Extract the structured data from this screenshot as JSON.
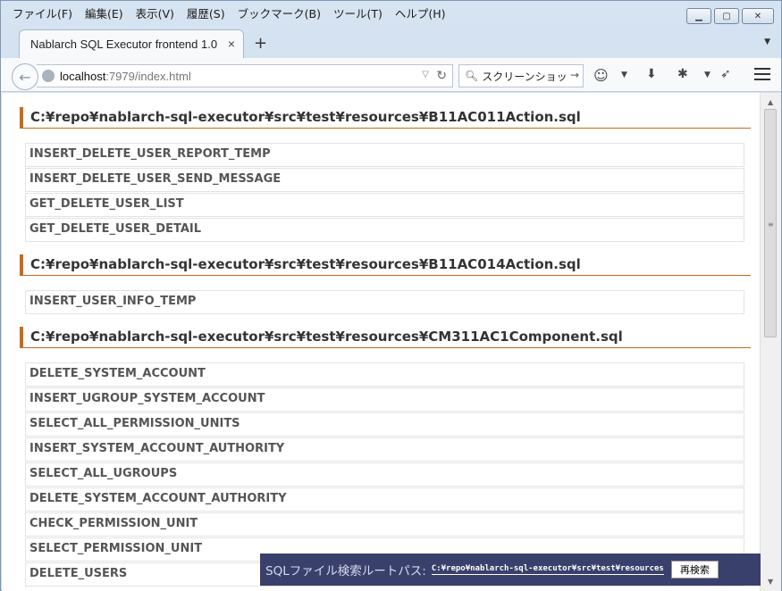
{
  "menubar": {
    "items": [
      "ファイル(F)",
      "編集(E)",
      "表示(V)",
      "履歴(S)",
      "ブックマーク(B)",
      "ツール(T)",
      "ヘルプ(H)"
    ]
  },
  "tab": {
    "title": "Nablarch SQL Executor frontend 1.0",
    "close": "×"
  },
  "new_tab": "+",
  "nav": {
    "url_host": "localhost",
    "url_rest": ":7979/index.html",
    "search_placeholder": "スクリーンショッ"
  },
  "sql_files": [
    {
      "path": "C:¥repo¥nablarch-sql-executor¥src¥test¥resources¥B11AC011Action.sql",
      "statements": [
        "INSERT_DELETE_USER_REPORT_TEMP",
        "INSERT_DELETE_USER_SEND_MESSAGE",
        "GET_DELETE_USER_LIST",
        "GET_DELETE_USER_DETAIL"
      ]
    },
    {
      "path": "C:¥repo¥nablarch-sql-executor¥src¥test¥resources¥B11AC014Action.sql",
      "statements": [
        "INSERT_USER_INFO_TEMP"
      ]
    },
    {
      "path": "C:¥repo¥nablarch-sql-executor¥src¥test¥resources¥CM311AC1Component.sql",
      "statements": [
        "DELETE_SYSTEM_ACCOUNT",
        "INSERT_UGROUP_SYSTEM_ACCOUNT",
        "SELECT_ALL_PERMISSION_UNITS",
        "INSERT_SYSTEM_ACCOUNT_AUTHORITY",
        "SELECT_ALL_UGROUPS",
        "DELETE_SYSTEM_ACCOUNT_AUTHORITY",
        "CHECK_PERMISSION_UNIT",
        "SELECT_PERMISSION_UNIT",
        "DELETE_USERS"
      ]
    }
  ],
  "footer": {
    "label": "SQLファイル検索ルートパス:",
    "path": "C:¥repo¥nablarch-sql-executor¥src¥test¥resources",
    "button": "再検索"
  }
}
